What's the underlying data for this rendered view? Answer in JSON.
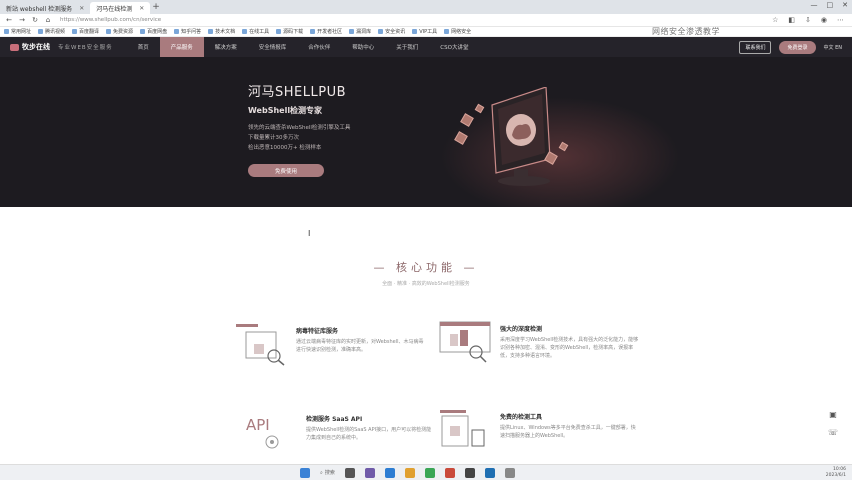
{
  "browser": {
    "tabs": [
      {
        "label": "新站 webshell 检测服务",
        "active": false
      },
      {
        "label": "河马在线检测",
        "active": true
      }
    ],
    "new_tab": "+",
    "window_controls": [
      "—",
      "□",
      "✕"
    ],
    "url": "https://www.shellpub.com/cn/service",
    "bookmarks": [
      "常用网址",
      "腾讯视频",
      "百度翻译",
      "免费资源",
      "百度网盘",
      "知乎问答",
      "技术文档",
      "在线工具",
      "源码下载",
      "开发者社区",
      "漏洞库",
      "安全资讯",
      "VIP工具",
      "网络安全"
    ]
  },
  "overlay_text": "网络安全渗透教学",
  "site": {
    "logo_text": "牧步在线",
    "slogan": "专业WEB安全服务",
    "nav": [
      {
        "label": "首页",
        "active": false
      },
      {
        "label": "产品服务",
        "active": true
      },
      {
        "label": "解决方案",
        "active": false
      },
      {
        "label": "安全情报库",
        "active": false
      },
      {
        "label": "合作伙伴",
        "active": false
      },
      {
        "label": "帮助中心",
        "active": false
      },
      {
        "label": "关于我们",
        "active": false
      },
      {
        "label": "CSO大讲堂",
        "active": false
      }
    ],
    "right": {
      "contact": "联系我们",
      "login": "免费登录",
      "user": "中文 EN"
    }
  },
  "hero": {
    "title": "河马SHELLPUB",
    "subtitle": "WebShell检测专家",
    "lines": [
      "领先的云端查杀WebShell检测引擎及工具",
      "下载量累计30多万次",
      "检出恶意10000万+ 检测样本"
    ],
    "button": "免费使用"
  },
  "section": {
    "title": "— 核心功能 —",
    "subtitle": "全面 · 精准 · 高效的WebShell检测服务"
  },
  "features": [
    {
      "title": "病毒特征库服务",
      "desc": "通过云端病毒特征库的实时更新，对Webshell、木马病毒进行快速识别检测，准确率高。"
    },
    {
      "title": "强大的深度检测",
      "desc": "采用深度学习WebShell检测技术，具有强大的泛化能力，能够识别各种加密、混淆、变形的WebShell，检测率高，误报率低，支持多种语言环境。"
    },
    {
      "title": "检测服务 SaaS API",
      "desc": "提供WebShell检测的SaaS API接口，用户可以将检测能力集成到自己的系统中。"
    },
    {
      "title": "免费的检测工具",
      "desc": "提供Linux、Windows等多平台免费查杀工具，一键部署，快速扫描服务器上的WebShell。"
    }
  ],
  "feature_icon_texts": {
    "api": "API"
  },
  "side_icons": [
    "chat-icon",
    "phone-icon"
  ],
  "taskbar": {
    "search": "搜索",
    "time": "10:06",
    "date": "2023/6/1"
  },
  "colors": {
    "accent": "#a97b7e",
    "nav_bg": "#25232a",
    "hero_bg": "#1d1b20",
    "title": "#8c6769"
  }
}
